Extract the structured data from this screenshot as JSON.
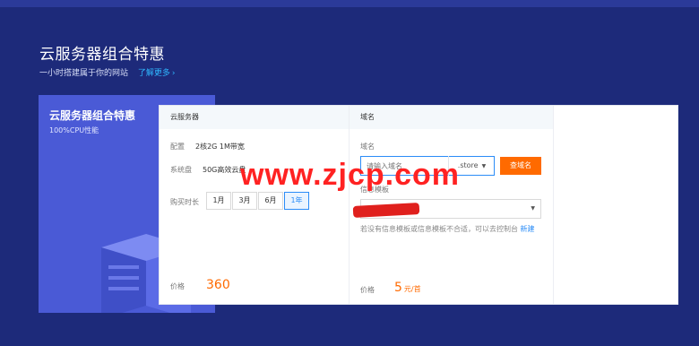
{
  "hero": {
    "title": "云服务器组合特惠",
    "subtitle": "一小时搭建属于你的网站",
    "link": "了解更多",
    "link_chevron": "›"
  },
  "promo": {
    "title": "云服务器组合特惠",
    "subtitle": "100%CPU性能"
  },
  "server": {
    "header": "云服务器",
    "config_label": "配置",
    "config_value": "2核2G  1M带宽",
    "disk_label": "系统盘",
    "disk_value": "50G高效云盘",
    "duration_label": "购买时长",
    "durations": [
      "1月",
      "3月",
      "6月",
      "1年"
    ],
    "selected_duration": "1年",
    "price_label": "价格",
    "price_value": "360"
  },
  "domain": {
    "header": "域名",
    "field_label": "域名",
    "input_placeholder": "请输入域名",
    "suffix": ".store",
    "search_button": "查域名",
    "template_label": "信息模板",
    "hint": "若没有信息模板或信息模板不合适，可以去控制台",
    "hint_link": "新建",
    "price_label": "价格",
    "price_value": "5",
    "price_unit": "元/首"
  },
  "watermark": "www.zjcp.com",
  "colors": {
    "background": "#1d2a7a",
    "accent_orange": "#ff6a00",
    "accent_blue": "#2b8cf7",
    "promo_panel": "#4a5ad6"
  }
}
